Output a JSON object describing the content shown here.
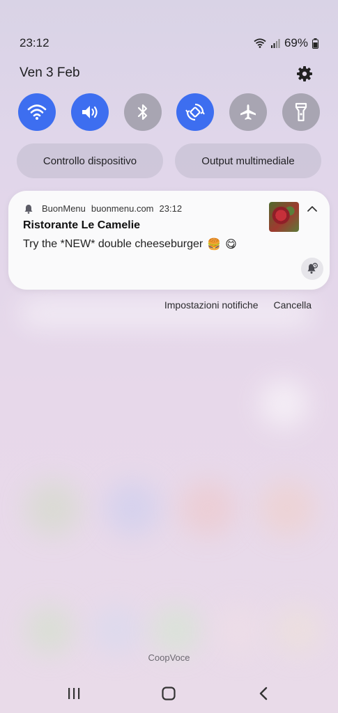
{
  "status_bar": {
    "time": "23:12",
    "battery": "69%",
    "icons": [
      "wifi-icon",
      "cellular-signal-icon",
      "battery-icon"
    ]
  },
  "header": {
    "date": "Ven 3 Feb",
    "settings_icon": "gear-icon"
  },
  "quick_settings": [
    {
      "name": "wifi",
      "icon": "wifi-icon",
      "state": "on"
    },
    {
      "name": "sound",
      "icon": "volume-icon",
      "state": "on"
    },
    {
      "name": "bluetooth",
      "icon": "bluetooth-icon",
      "state": "off"
    },
    {
      "name": "auto-rotate",
      "icon": "rotate-icon",
      "state": "on"
    },
    {
      "name": "airplane-mode",
      "icon": "airplane-icon",
      "state": "off"
    },
    {
      "name": "flashlight",
      "icon": "flashlight-icon",
      "state": "off"
    }
  ],
  "pills": {
    "device_control": "Controllo dispositivo",
    "media_output": "Output multimediale"
  },
  "notification": {
    "app_name": "BuonMenu",
    "source": "buonmenu.com",
    "time": "23:12",
    "title": "Ristorante Le Camelie",
    "body": "Try the *NEW* double cheeseburger",
    "emojis": [
      "🍔",
      "😋"
    ]
  },
  "notification_actions": {
    "settings": "Impostazioni notifiche",
    "clear": "Cancella"
  },
  "carrier": "CoopVoce",
  "nav_bar": [
    "recents-icon",
    "home-icon",
    "back-icon"
  ],
  "colors": {
    "accent": "#3d6ef0",
    "tile_off": "#a8a5b2",
    "card": "#fafafb"
  }
}
